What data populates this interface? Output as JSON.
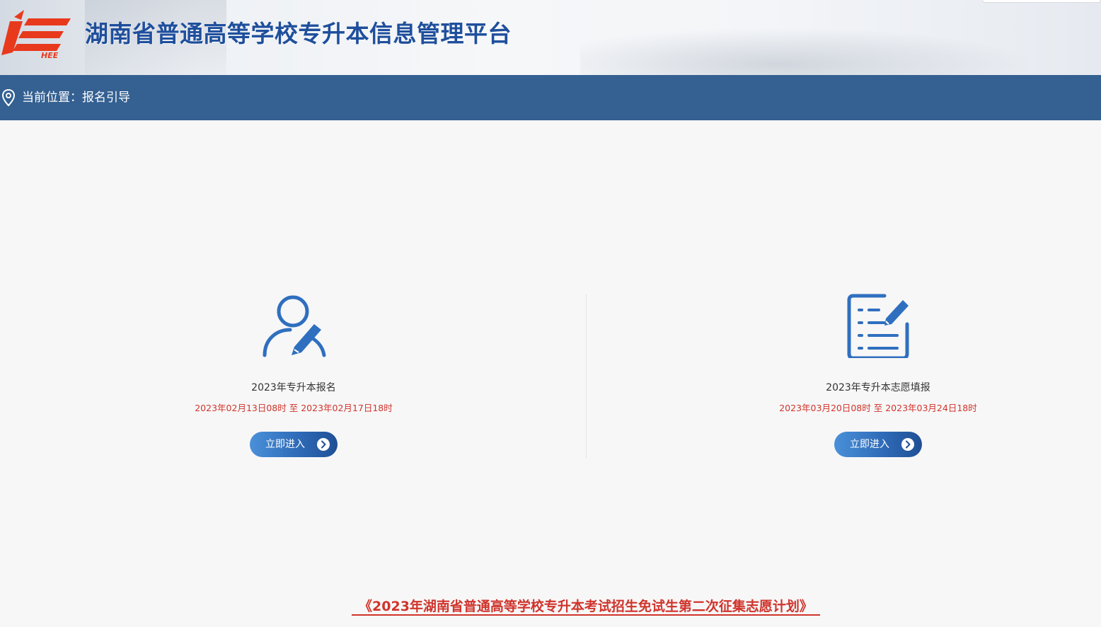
{
  "header": {
    "logo_text": "HEE",
    "site_title": "湖南省普通高等学校专升本信息管理平台"
  },
  "location": {
    "icon": "location-pin-icon",
    "label": "当前位置：报名引导"
  },
  "cards": [
    {
      "icon": "user-edit-icon",
      "title": "2023年专升本报名",
      "date_range": "2023年02月13日08时 至 2023年02月17日18时",
      "button_label": "立即进入"
    },
    {
      "icon": "form-edit-icon",
      "title": "2023年专升本志愿填报",
      "date_range": "2023年03月20日08时 至 2023年03月24日18时",
      "button_label": "立即进入"
    }
  ],
  "notice": {
    "text": "《2023年湖南省普通高等学校专升本考试招生免试生第二次征集志愿计划》"
  },
  "colors": {
    "primary_blue": "#346092",
    "title_blue": "#1f4f9c",
    "accent_red": "#d0342c",
    "logo_red": "#e8391d",
    "icon_blue": "#2f6fbf"
  }
}
